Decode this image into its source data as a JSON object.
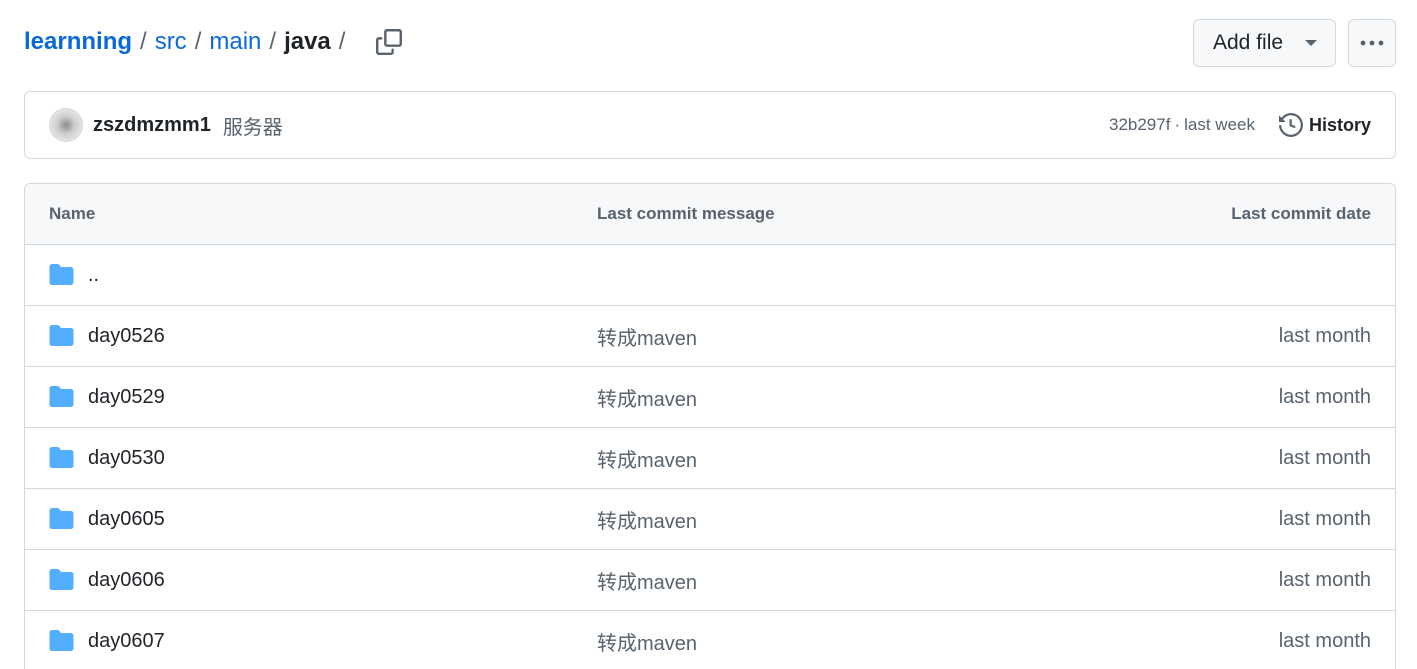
{
  "breadcrumb": {
    "repo": "learnning",
    "parts": [
      "src",
      "main"
    ],
    "current": "java",
    "separator": "/"
  },
  "toolbar": {
    "add_file_label": "Add file",
    "more_icon": "kebab-horizontal-icon"
  },
  "commit": {
    "author": "zszdmzmm1",
    "message": "服务器",
    "hash": "32b297f",
    "time": "last week",
    "meta_sep": "·",
    "history_label": "History"
  },
  "table": {
    "headers": {
      "name": "Name",
      "message": "Last commit message",
      "date": "Last commit date"
    },
    "parent": "..",
    "rows": [
      {
        "name": "day0526",
        "message": "转成maven",
        "date": "last month"
      },
      {
        "name": "day0529",
        "message": "转成maven",
        "date": "last month"
      },
      {
        "name": "day0530",
        "message": "转成maven",
        "date": "last month"
      },
      {
        "name": "day0605",
        "message": "转成maven",
        "date": "last month"
      },
      {
        "name": "day0606",
        "message": "转成maven",
        "date": "last month"
      },
      {
        "name": "day0607",
        "message": "转成maven",
        "date": "last month"
      }
    ]
  },
  "colors": {
    "link": "#0969da",
    "folder": "#54aeff",
    "border": "#d1d9e0",
    "muted": "#59636e",
    "header_bg": "#f6f8fa"
  }
}
